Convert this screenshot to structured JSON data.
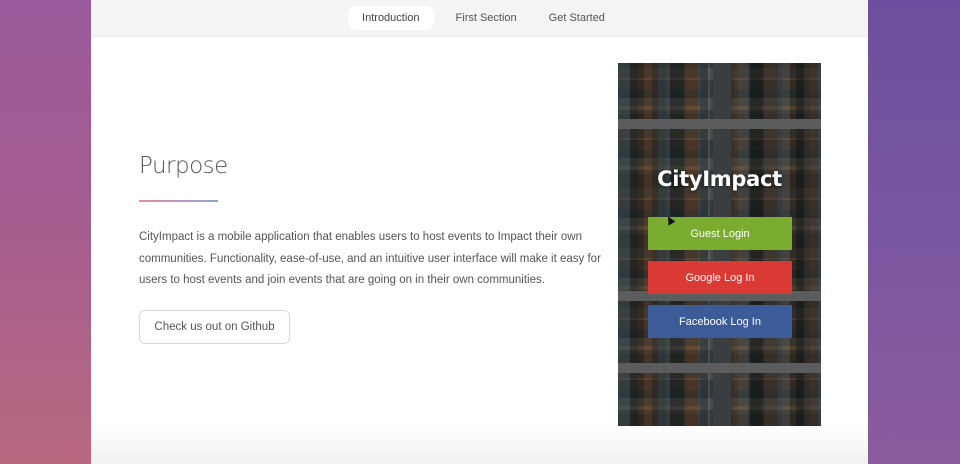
{
  "nav": {
    "items": [
      "Introduction",
      "First Section",
      "Get Started"
    ],
    "active": "Introduction"
  },
  "main": {
    "title": "Purpose",
    "description": "CityImpact is a mobile application that enables users to host events to Impact their own communities. Functionality, ease-of-use, and an intuitive user interface will make it easy for users to host events and join events that are going on in their own communities.",
    "github_button": "Check us out on Github"
  },
  "phone": {
    "app_title": "CityImpact",
    "guest_login": "Guest Login",
    "google_login": "Google Log In",
    "facebook_login": "Facebook Log In"
  },
  "colors": {
    "guest": "#79ac2f",
    "google": "#d93b34",
    "facebook": "#3b5c99"
  }
}
